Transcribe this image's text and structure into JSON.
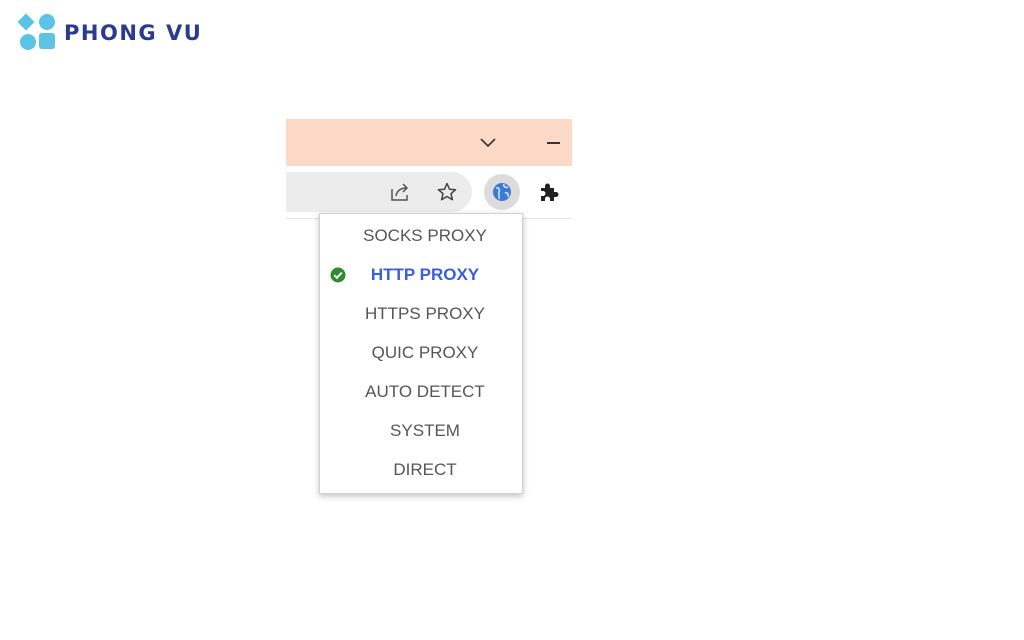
{
  "watermark": {
    "logo_text": "PHONG VU"
  },
  "browser": {
    "titlebar_icons": [
      "chevron-down-icon",
      "minimize-icon"
    ],
    "toolbar_icons": [
      "share-icon",
      "bookmark-star-icon",
      "proxy-extension-icon",
      "extensions-puzzle-icon"
    ]
  },
  "proxy_menu": {
    "selected": "HTTP PROXY",
    "items": [
      {
        "label": "SOCKS PROXY"
      },
      {
        "label": "HTTP PROXY"
      },
      {
        "label": "HTTPS PROXY"
      },
      {
        "label": "QUIC PROXY"
      },
      {
        "label": "AUTO DETECT"
      },
      {
        "label": "SYSTEM"
      },
      {
        "label": "DIRECT"
      }
    ]
  },
  "colors": {
    "titlebar": "#fcd9c6",
    "active_item": "#3a5fd9",
    "check": "#2e8b2e",
    "logo_text": "#2b3a8f",
    "logo_mark": "#5bc3e6"
  }
}
